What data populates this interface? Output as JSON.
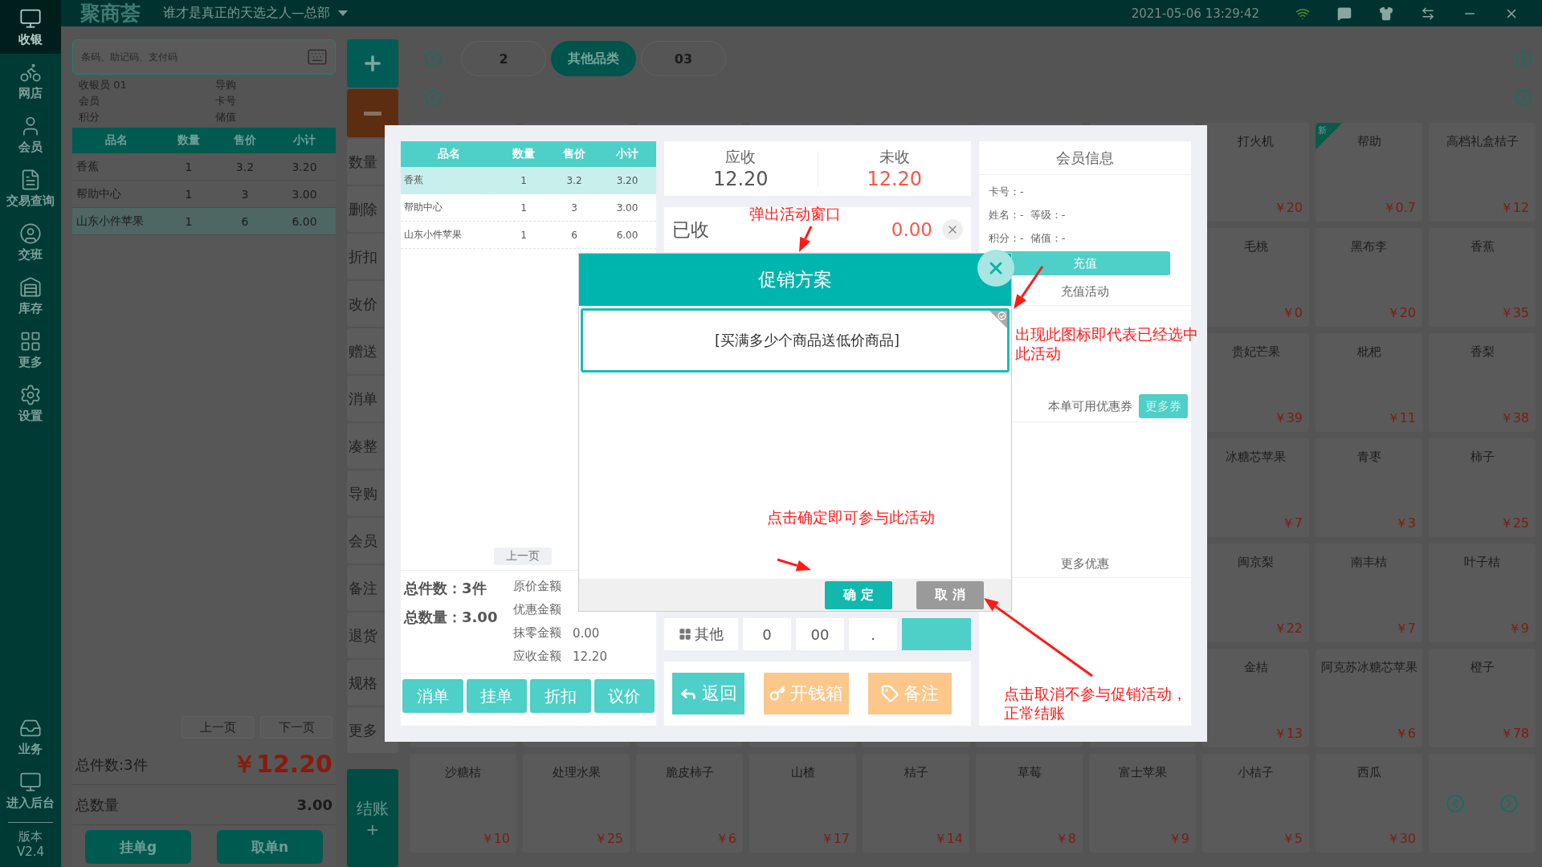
{
  "top_bar": {
    "logo": "聚商荟",
    "store": "谁才是真正的天选之人—总部",
    "datetime": "2021-05-06 13:29:42"
  },
  "sidebar": {
    "items": [
      {
        "kind": "cashier",
        "label": "收银",
        "selected": true
      },
      {
        "kind": "shop",
        "label": "网店",
        "selected": false
      },
      {
        "kind": "member",
        "label": "会员",
        "selected": false
      },
      {
        "kind": "query",
        "label": "交易查询",
        "selected": false
      },
      {
        "kind": "shift",
        "label": "交班",
        "selected": false
      },
      {
        "kind": "stock",
        "label": "库存",
        "selected": false
      },
      {
        "kind": "more",
        "label": "更多",
        "selected": false
      },
      {
        "kind": "settings",
        "label": "设置",
        "selected": false
      }
    ],
    "bottom_items": [
      {
        "kind": "business",
        "label": "业务"
      },
      {
        "kind": "backend",
        "label": "进入后台"
      }
    ],
    "version_label": "版本",
    "version": "V2.4"
  },
  "cart": {
    "search_placeholder": "条码、助记码、支付码",
    "info": [
      {
        "label": "收银员",
        "value": "01"
      },
      {
        "label": "导购"
      },
      {
        "label": "会员"
      },
      {
        "label": "卡号"
      },
      {
        "label": "积分"
      },
      {
        "label": "储值"
      }
    ],
    "columns": [
      "品名",
      "数量",
      "售价",
      "小计"
    ],
    "rows": [
      {
        "cells": [
          "香蕉",
          "1",
          "3.2",
          "3.20"
        ],
        "selected": false
      },
      {
        "cells": [
          "帮助中心",
          "1",
          "3",
          "3.00"
        ],
        "selected": false
      },
      {
        "cells": [
          "山东小件苹果",
          "1",
          "6",
          "6.00"
        ],
        "selected": true
      }
    ],
    "prev": "上一页",
    "next": "下一页",
    "total_items": "总件数:3件",
    "total_amount": "￥12.20",
    "qty_label": "总数量",
    "qty": "3.00",
    "buttons": [
      "挂单g",
      "取单n"
    ]
  },
  "functions": {
    "labels": [
      "数量",
      "删除",
      "折扣",
      "改价",
      "赠送",
      "消单",
      "凑整",
      "导购",
      "会员",
      "备注",
      "退货",
      "规格",
      "更多"
    ],
    "checkout": "结账",
    "checkout_key": "+"
  },
  "products": {
    "categories": [
      {
        "label": "2",
        "selected": false
      },
      {
        "label": "其他品类",
        "selected": true
      },
      {
        "label": "03",
        "selected": false
      }
    ],
    "rows": [
      {
        "kind": "partial",
        "cards": [
          {
            "name": "打火机",
            "price": "￥20"
          },
          {
            "name": "帮助",
            "price": "￥0.7",
            "badge": "新"
          },
          {
            "name": "高档礼盒桔子",
            "price": "￥12"
          }
        ]
      },
      {
        "kind": "partial",
        "cards": [
          {
            "name": "毛桃",
            "price": "￥0"
          },
          {
            "name": "黑布李",
            "price": "￥20"
          },
          {
            "name": "香蕉",
            "price": "￥35"
          }
        ]
      },
      {
        "kind": "partial",
        "cards": [
          {
            "name": "贵妃芒果",
            "price": "￥39"
          },
          {
            "name": "枇杷",
            "price": "￥11"
          },
          {
            "name": "香梨",
            "price": "￥38"
          }
        ]
      },
      {
        "kind": "partial",
        "cards": [
          {
            "name": "冰糖芯苹果",
            "price": "￥7"
          },
          {
            "name": "青枣",
            "price": "￥3"
          },
          {
            "name": "柿子",
            "price": "￥25"
          }
        ]
      },
      {
        "kind": "partial",
        "cards": [
          {
            "name": "闽京梨",
            "price": "￥22"
          },
          {
            "name": "南丰桔",
            "price": "￥7"
          },
          {
            "name": "叶子桔",
            "price": "￥9"
          }
        ]
      },
      {
        "kind": "partial",
        "cards": [
          {
            "name": "金桔",
            "price": "￥13"
          },
          {
            "name": "阿克苏冰糖芯苹果",
            "price": "￥6"
          },
          {
            "name": "橙子",
            "price": "￥78"
          }
        ]
      },
      {
        "kind": "full",
        "cards": [
          {
            "name": "沙糖桔",
            "price": "￥10"
          },
          {
            "name": "处理水果",
            "price": "￥25"
          },
          {
            "name": "脆皮柿子",
            "price": "￥6"
          },
          {
            "name": "山楂",
            "price": "￥17"
          },
          {
            "name": "桔子",
            "price": "￥14"
          },
          {
            "name": "草莓",
            "price": "￥8"
          },
          {
            "name": "富士苹果",
            "price": "￥9"
          },
          {
            "name": "小桔子",
            "price": "￥5"
          },
          {
            "name": "西瓜",
            "price": "￥30"
          }
        ]
      }
    ]
  },
  "payment": {
    "columns": [
      "品名",
      "数量",
      "售价",
      "小计"
    ],
    "rows": [
      {
        "cells": [
          "香蕉",
          "1",
          "3.2",
          "3.20"
        ],
        "selected": true
      },
      {
        "cells": [
          "帮助中心",
          "1",
          "3",
          "3.00"
        ],
        "selected": false
      },
      {
        "cells": [
          "山东小件苹果",
          "1",
          "6",
          "6.00"
        ],
        "selected": false
      }
    ],
    "prev_page": "上一页",
    "totals": [
      {
        "label": "总件数：",
        "value": "3件"
      },
      {
        "label": "总数量：",
        "value": "3.00"
      }
    ],
    "amounts": [
      {
        "label": "原价金额"
      },
      {
        "label": "优惠金额"
      },
      {
        "label": "抹零金额",
        "value": "0.00"
      },
      {
        "label": "应收金额",
        "value": "12.20"
      }
    ],
    "actions": [
      "消单",
      "挂单",
      "折扣",
      "议价"
    ],
    "receivable": {
      "label": "应收",
      "value": "12.20"
    },
    "unpaid": {
      "label": "未收",
      "value": "12.20"
    },
    "received": {
      "label": "已收",
      "value": "0.00"
    },
    "keypad": [
      {
        "kind": "other",
        "label": "其他"
      },
      {
        "kind": "key",
        "label": "0"
      },
      {
        "kind": "key",
        "label": "00"
      },
      {
        "kind": "key",
        "label": "."
      },
      {
        "kind": "action"
      }
    ],
    "bottom_buttons": [
      {
        "kind": "back",
        "label": "返回"
      },
      {
        "kind": "drawer",
        "label": "开钱箱"
      },
      {
        "kind": "note",
        "label": "备注"
      }
    ],
    "member": {
      "title": "会员信息",
      "lines": [
        [
          "卡号：-"
        ],
        [
          "姓名：-",
          "等级：-"
        ],
        [
          "积分：-",
          "储值：-"
        ]
      ],
      "recharge": "充值",
      "recharge_activity": "充值活动",
      "coupons": "本单可用优惠券",
      "more_coupons": "更多券",
      "more_offers": "更多优惠"
    }
  },
  "promotion": {
    "title": "促销方案",
    "items": [
      {
        "name": "[买满多少个商品送低价商品]",
        "selected": true
      }
    ],
    "confirm": "确 定",
    "cancel": "取 消"
  },
  "annotations": [
    {
      "text": "弹出活动窗口"
    },
    {
      "text": "出现此图标即代表已经选中此活动"
    },
    {
      "text": "点击确定即可参与此活动"
    },
    {
      "text": "点击取消不参与促销活动，正常结账"
    }
  ]
}
